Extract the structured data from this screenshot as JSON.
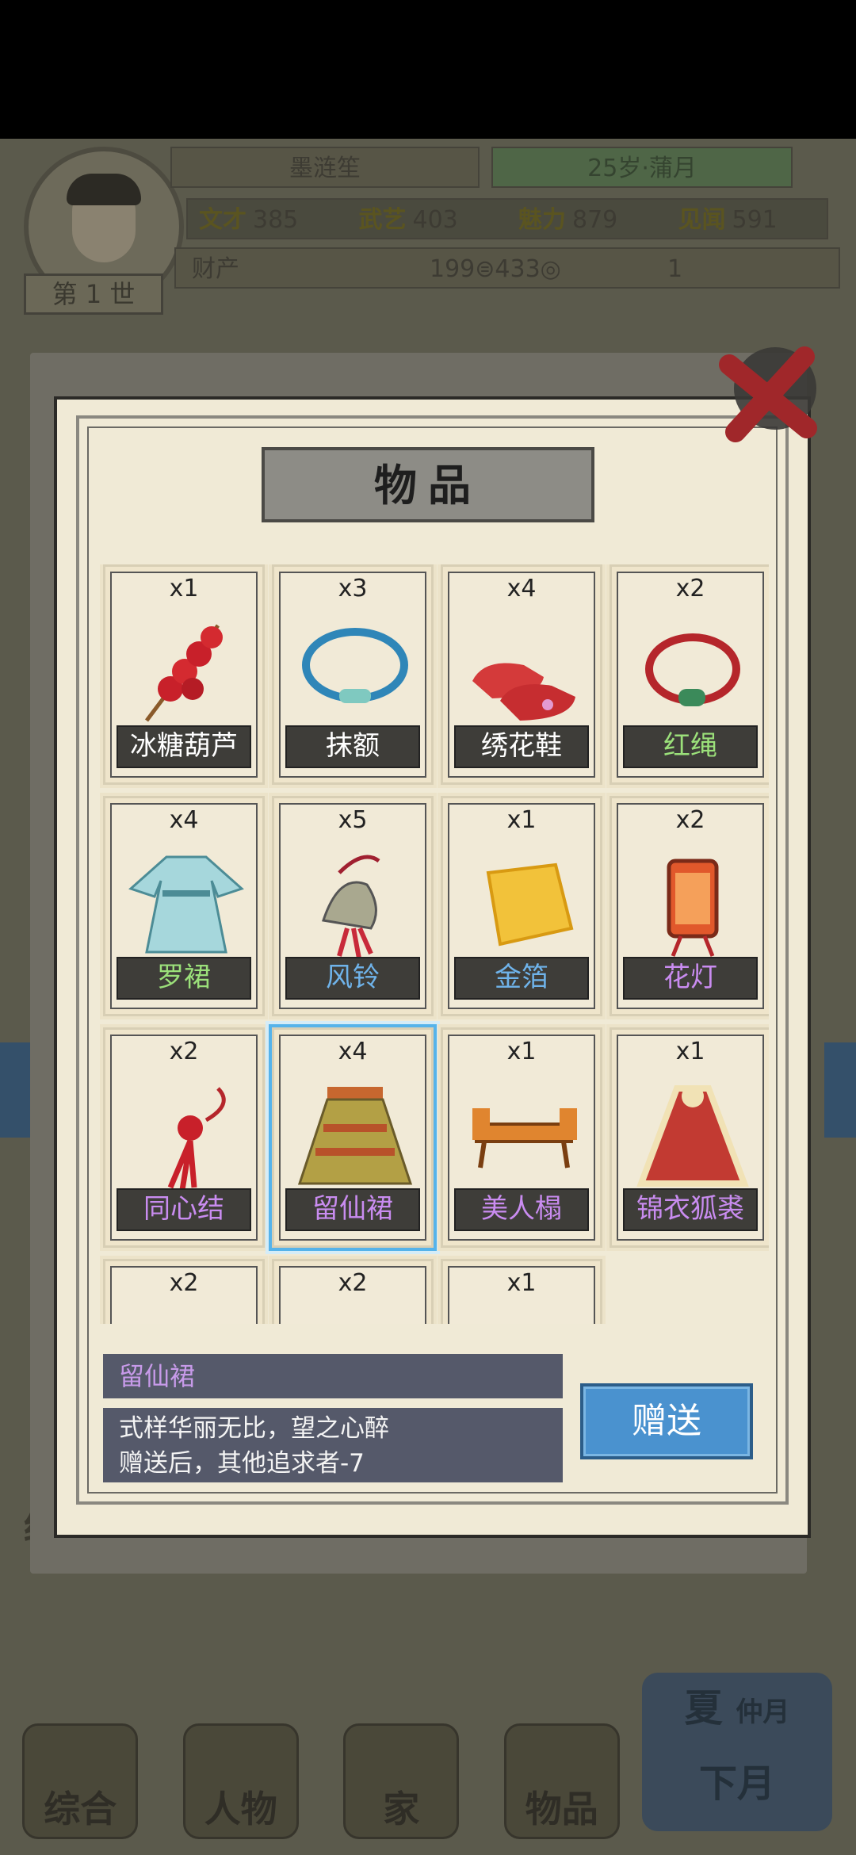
{
  "header": {
    "player_name": "墨涟笙",
    "age_month": "25岁·蒲月",
    "generation": "第 1 世",
    "stats": [
      {
        "label": "文才",
        "value": "385"
      },
      {
        "label": "武艺",
        "value": "403"
      },
      {
        "label": "魅力",
        "value": "879"
      },
      {
        "label": "见闻",
        "value": "591"
      }
    ],
    "wealth_label": "财产",
    "wealth_values": "199⊜433◎",
    "wealth_extra": "1"
  },
  "nav": {
    "jingying": "经营",
    "items": [
      "综合",
      "人物",
      "家",
      "物品"
    ],
    "season": "夏",
    "month": "仲月",
    "next_month": "下月"
  },
  "dialog": {
    "title": "物品",
    "items": [
      {
        "count": "x1",
        "name": "冰糖葫芦",
        "color": "#ffffff",
        "icon": "candied-haws-icon"
      },
      {
        "count": "x3",
        "name": "抹额",
        "color": "#ffffff",
        "icon": "headband-icon"
      },
      {
        "count": "x4",
        "name": "绣花鞋",
        "color": "#ffffff",
        "icon": "embroidered-shoes-icon"
      },
      {
        "count": "x2",
        "name": "红绳",
        "color": "#9be07a",
        "icon": "red-cord-icon"
      },
      {
        "count": "x4",
        "name": "罗裙",
        "color": "#9be07a",
        "icon": "dress-icon"
      },
      {
        "count": "x5",
        "name": "风铃",
        "color": "#6fb3ea",
        "icon": "wind-chime-icon"
      },
      {
        "count": "x1",
        "name": "金箔",
        "color": "#6fb3ea",
        "icon": "gold-foil-icon"
      },
      {
        "count": "x2",
        "name": "花灯",
        "color": "#c98cf0",
        "icon": "lantern-icon"
      },
      {
        "count": "x2",
        "name": "同心结",
        "color": "#c98cf0",
        "icon": "knot-icon"
      },
      {
        "count": "x4",
        "name": "留仙裙",
        "color": "#c98cf0",
        "icon": "pleated-skirt-icon"
      },
      {
        "count": "x1",
        "name": "美人榻",
        "color": "#c98cf0",
        "icon": "couch-icon"
      },
      {
        "count": "x1",
        "name": "锦衣狐裘",
        "color": "#c98cf0",
        "icon": "fur-cloak-icon"
      },
      {
        "count": "x2",
        "name": "",
        "color": "#ffffff",
        "icon": "item-icon"
      },
      {
        "count": "x2",
        "name": "",
        "color": "#ffffff",
        "icon": "item-icon"
      },
      {
        "count": "x1",
        "name": "",
        "color": "#ffffff",
        "icon": "item-icon"
      }
    ],
    "selected_index": 9,
    "info": {
      "name": "留仙裙",
      "desc_line1": "式样华丽无比，望之心醉",
      "desc_line2": "赠送后，其他追求者-7"
    },
    "gift_button": "赠送"
  }
}
